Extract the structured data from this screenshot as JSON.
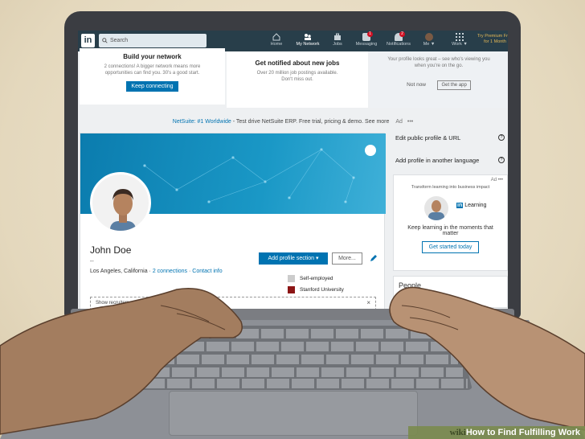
{
  "nav": {
    "search_placeholder": "Search",
    "items": [
      {
        "label": "Home",
        "icon": "home-icon"
      },
      {
        "label": "My Network",
        "icon": "network-icon"
      },
      {
        "label": "Jobs",
        "icon": "briefcase-icon"
      },
      {
        "label": "Messaging",
        "icon": "messaging-icon",
        "badge": "1"
      },
      {
        "label": "Notifications",
        "icon": "bell-icon",
        "badge": "2"
      },
      {
        "label": "Me ▼",
        "icon": "avatar-icon"
      },
      {
        "label": "Work ▼",
        "icon": "grid-icon"
      }
    ],
    "premium": "Try Premium Free for 1 Month"
  },
  "cards": {
    "network": {
      "title": "Build your network",
      "line1": "2 connections! A bigger network means more",
      "line2": "opportunities can find you. 30's a good start.",
      "button": "Keep connecting"
    },
    "jobs": {
      "title": "Get notified about new jobs",
      "line1": "Over 20 million job postings available.",
      "line2": "Don't miss out."
    },
    "app": {
      "line1": "Your profile looks great – see who's viewing you",
      "line2": "when you're on the go.",
      "not_now": "Not now",
      "get_app": "Get the app"
    }
  },
  "ad_strip": {
    "brand": "NetSuite: #1 Worldwide",
    "text": " - Test drive NetSuite ERP. Free trial, pricing & demo. See more",
    "ad": "Ad",
    "more": "•••"
  },
  "profile": {
    "name": "John Doe",
    "headline": "--",
    "location": "Los Angeles, California",
    "connections": "2 connections",
    "contact": "Contact info",
    "add_section": "Add profile section ▾",
    "more": "More...",
    "org1": "Self-employed",
    "org2": "Stanford University",
    "show_recruiters": "Show recruiters you're open ... control who sees this"
  },
  "rail": {
    "edit_url": "Edit public profile & URL",
    "add_language": "Add profile in another language",
    "ad_label": "Ad",
    "ad_tag": "Transform learning into business impact",
    "learning": "Learning",
    "line1": "Keep learning in the moments that",
    "line2": "matter",
    "cta": "Get started today",
    "people": "People"
  },
  "watermark": {
    "wiki": "wiki",
    "text": "How to Find Fulfilling Work"
  },
  "colors": {
    "linkedin_blue": "#0073b1",
    "nav_dark": "#283e4a",
    "badge_red": "#d11124"
  }
}
